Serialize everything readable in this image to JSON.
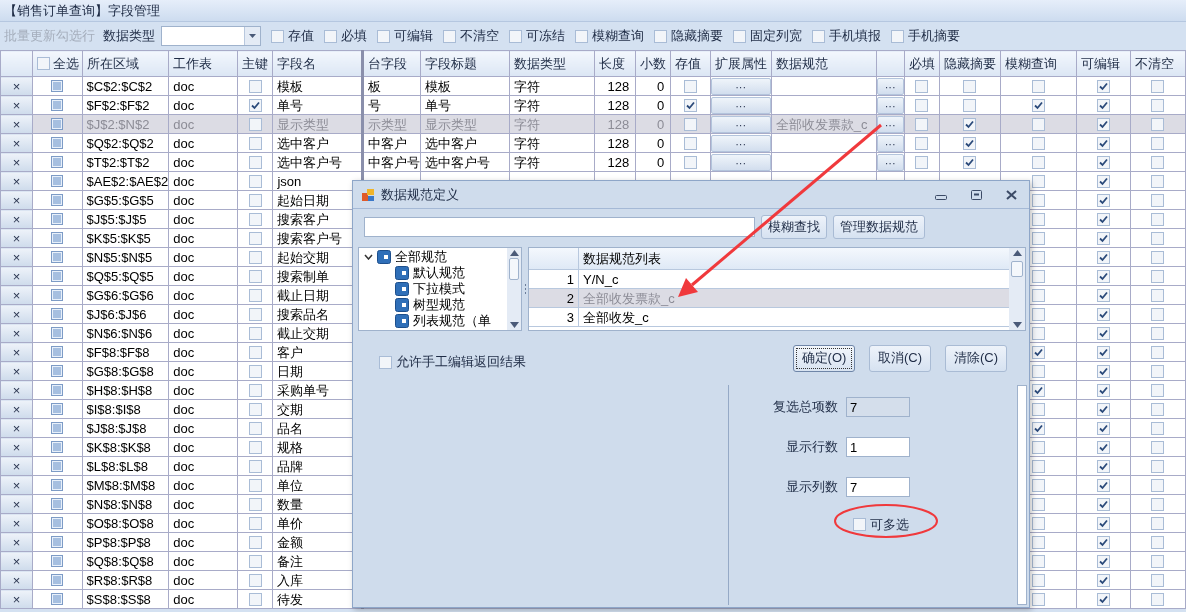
{
  "window": {
    "title": "【销售订单查询】字段管理"
  },
  "toolbar": {
    "batch_update": {
      "label": "批量更新勾选行",
      "disabled": true
    },
    "data_type_label": "数据类型",
    "options": [
      {
        "label": "存值",
        "checked": false
      },
      {
        "label": "必填",
        "checked": false
      },
      {
        "label": "可编辑",
        "checked": false
      },
      {
        "label": "不清空",
        "checked": false
      },
      {
        "label": "可冻结",
        "checked": false
      },
      {
        "label": "模糊查询",
        "checked": false
      },
      {
        "label": "隐藏摘要",
        "checked": false
      },
      {
        "label": "固定列宽",
        "checked": false
      },
      {
        "label": "手机填报",
        "checked": false
      },
      {
        "label": "手机摘要",
        "checked": false
      }
    ]
  },
  "table": {
    "columns": [
      {
        "kind": "delete"
      },
      {
        "kind": "select",
        "label": "全选",
        "checked": false
      },
      {
        "kind": "text",
        "label": "所在区域"
      },
      {
        "kind": "text",
        "label": "工作表"
      },
      {
        "kind": "check",
        "label": "主键"
      },
      {
        "kind": "text",
        "label": "字段名"
      },
      {
        "kind": "text",
        "label": "台字段"
      },
      {
        "kind": "text",
        "label": "字段标题"
      },
      {
        "kind": "text",
        "label": "数据类型"
      },
      {
        "kind": "num",
        "label": "长度"
      },
      {
        "kind": "num",
        "label": "小数"
      },
      {
        "kind": "check",
        "label": "存值"
      },
      {
        "kind": "button",
        "label": "扩展属性"
      },
      {
        "kind": "text",
        "label": "数据规范"
      },
      {
        "kind": "button"
      },
      {
        "kind": "check",
        "label": "必填"
      },
      {
        "kind": "check",
        "label": "隐藏摘要"
      },
      {
        "kind": "check",
        "label": "模糊查询"
      },
      {
        "kind": "check",
        "label": "可编辑"
      },
      {
        "kind": "check",
        "label": "不清空"
      }
    ],
    "rows": [
      {
        "selected": false,
        "cells": [
          "×",
          null,
          "$C$2:$C$2",
          "doc",
          false,
          "模板",
          "板",
          "模板",
          "字符",
          "128",
          "0",
          false,
          "···",
          null,
          "···",
          false,
          false,
          false,
          true,
          false
        ]
      },
      {
        "selected": false,
        "cells": [
          "×",
          null,
          "$F$2:$F$2",
          "doc",
          true,
          "单号",
          "号",
          "单号",
          "字符",
          "128",
          "0",
          true,
          "···",
          null,
          "···",
          false,
          false,
          true,
          true,
          false
        ]
      },
      {
        "selected": true,
        "cells": [
          "×",
          null,
          "$J$2:$N$2",
          "doc",
          false,
          "显示类型",
          "示类型",
          "显示类型",
          "字符",
          "128",
          "0",
          false,
          "···",
          "全部收发票款_c",
          "···",
          false,
          true,
          false,
          true,
          false
        ]
      },
      {
        "selected": false,
        "cells": [
          "×",
          null,
          "$Q$2:$Q$2",
          "doc",
          false,
          "选中客户",
          "中客户",
          "选中客户",
          "字符",
          "128",
          "0",
          false,
          "···",
          null,
          "···",
          false,
          true,
          false,
          true,
          false
        ]
      },
      {
        "selected": false,
        "cells": [
          "×",
          null,
          "$T$2:$T$2",
          "doc",
          false,
          "选中客户号",
          "中客户号",
          "选中客户号",
          "字符",
          "128",
          "0",
          false,
          "···",
          null,
          "···",
          false,
          true,
          false,
          true,
          false
        ]
      },
      {
        "selected": false,
        "cells": [
          "×",
          null,
          "$AE$2:$AE$2",
          "doc",
          false,
          "json",
          null,
          null,
          null,
          null,
          null,
          null,
          null,
          null,
          null,
          null,
          null,
          false,
          true,
          false
        ]
      },
      {
        "selected": false,
        "cells": [
          "×",
          null,
          "$G$5:$G$5",
          "doc",
          false,
          "起始日期",
          null,
          null,
          null,
          null,
          null,
          null,
          null,
          null,
          null,
          null,
          null,
          false,
          true,
          false
        ]
      },
      {
        "selected": false,
        "cells": [
          "×",
          null,
          "$J$5:$J$5",
          "doc",
          false,
          "搜索客户",
          null,
          null,
          null,
          null,
          null,
          null,
          null,
          null,
          null,
          null,
          null,
          false,
          true,
          false
        ]
      },
      {
        "selected": false,
        "cells": [
          "×",
          null,
          "$K$5:$K$5",
          "doc",
          false,
          "搜索客户号",
          null,
          null,
          null,
          null,
          null,
          null,
          null,
          null,
          null,
          null,
          null,
          false,
          true,
          false
        ]
      },
      {
        "selected": false,
        "cells": [
          "×",
          null,
          "$N$5:$N$5",
          "doc",
          false,
          "起始交期",
          null,
          null,
          null,
          null,
          null,
          null,
          null,
          null,
          null,
          null,
          null,
          false,
          true,
          false
        ]
      },
      {
        "selected": false,
        "cells": [
          "×",
          null,
          "$Q$5:$Q$5",
          "doc",
          false,
          "搜索制单",
          null,
          null,
          null,
          null,
          null,
          null,
          null,
          null,
          null,
          null,
          null,
          false,
          true,
          false
        ]
      },
      {
        "selected": false,
        "cells": [
          "×",
          null,
          "$G$6:$G$6",
          "doc",
          false,
          "截止日期",
          null,
          null,
          null,
          null,
          null,
          null,
          null,
          null,
          null,
          null,
          null,
          false,
          true,
          false
        ]
      },
      {
        "selected": false,
        "cells": [
          "×",
          null,
          "$J$6:$J$6",
          "doc",
          false,
          "搜索品名",
          null,
          null,
          null,
          null,
          null,
          null,
          null,
          null,
          null,
          null,
          null,
          false,
          true,
          false
        ]
      },
      {
        "selected": false,
        "cells": [
          "×",
          null,
          "$N$6:$N$6",
          "doc",
          false,
          "截止交期",
          null,
          null,
          null,
          null,
          null,
          null,
          null,
          null,
          null,
          null,
          null,
          false,
          true,
          false
        ]
      },
      {
        "selected": false,
        "cells": [
          "×",
          null,
          "$F$8:$F$8",
          "doc",
          false,
          "客户",
          null,
          null,
          null,
          null,
          null,
          null,
          null,
          null,
          null,
          null,
          null,
          true,
          true,
          false
        ]
      },
      {
        "selected": false,
        "cells": [
          "×",
          null,
          "$G$8:$G$8",
          "doc",
          false,
          "日期",
          null,
          null,
          null,
          null,
          null,
          null,
          null,
          null,
          null,
          null,
          null,
          false,
          true,
          false
        ]
      },
      {
        "selected": false,
        "cells": [
          "×",
          null,
          "$H$8:$H$8",
          "doc",
          false,
          "采购单号",
          null,
          null,
          null,
          null,
          null,
          null,
          null,
          null,
          null,
          null,
          null,
          true,
          true,
          false
        ]
      },
      {
        "selected": false,
        "cells": [
          "×",
          null,
          "$I$8:$I$8",
          "doc",
          false,
          "交期",
          null,
          null,
          null,
          null,
          null,
          null,
          null,
          null,
          null,
          null,
          null,
          false,
          true,
          false
        ]
      },
      {
        "selected": false,
        "cells": [
          "×",
          null,
          "$J$8:$J$8",
          "doc",
          false,
          "品名",
          null,
          null,
          null,
          null,
          null,
          null,
          null,
          null,
          null,
          null,
          null,
          true,
          true,
          false
        ]
      },
      {
        "selected": false,
        "cells": [
          "×",
          null,
          "$K$8:$K$8",
          "doc",
          false,
          "规格",
          null,
          null,
          null,
          null,
          null,
          null,
          null,
          null,
          null,
          null,
          null,
          false,
          true,
          false
        ]
      },
      {
        "selected": false,
        "cells": [
          "×",
          null,
          "$L$8:$L$8",
          "doc",
          false,
          "品牌",
          null,
          null,
          null,
          null,
          null,
          null,
          null,
          null,
          null,
          null,
          null,
          false,
          true,
          false
        ]
      },
      {
        "selected": false,
        "cells": [
          "×",
          null,
          "$M$8:$M$8",
          "doc",
          false,
          "单位",
          null,
          null,
          null,
          null,
          null,
          null,
          null,
          null,
          null,
          null,
          null,
          false,
          true,
          false
        ]
      },
      {
        "selected": false,
        "cells": [
          "×",
          null,
          "$N$8:$N$8",
          "doc",
          false,
          "数量",
          null,
          null,
          null,
          null,
          null,
          null,
          null,
          null,
          null,
          null,
          null,
          false,
          true,
          false
        ]
      },
      {
        "selected": false,
        "cells": [
          "×",
          null,
          "$O$8:$O$8",
          "doc",
          false,
          "单价",
          null,
          null,
          null,
          null,
          null,
          null,
          null,
          null,
          null,
          null,
          null,
          false,
          true,
          false
        ]
      },
      {
        "selected": false,
        "cells": [
          "×",
          null,
          "$P$8:$P$8",
          "doc",
          false,
          "金额",
          null,
          null,
          null,
          null,
          null,
          null,
          null,
          null,
          null,
          null,
          null,
          false,
          true,
          false
        ]
      },
      {
        "selected": false,
        "cells": [
          "×",
          null,
          "$Q$8:$Q$8",
          "doc",
          false,
          "备注",
          null,
          null,
          null,
          null,
          null,
          null,
          null,
          null,
          null,
          null,
          null,
          false,
          true,
          false
        ]
      },
      {
        "selected": false,
        "cells": [
          "×",
          null,
          "$R$8:$R$8",
          "doc",
          false,
          "入库",
          null,
          null,
          null,
          null,
          null,
          null,
          null,
          null,
          null,
          null,
          null,
          false,
          true,
          false
        ]
      },
      {
        "selected": false,
        "cells": [
          "×",
          null,
          "$S$8:$S$8",
          "doc",
          false,
          "待发",
          null,
          null,
          null,
          null,
          null,
          null,
          null,
          null,
          null,
          null,
          null,
          false,
          true,
          false
        ]
      }
    ]
  },
  "dialog": {
    "title": "数据规范定义",
    "search_buttons": [
      "模糊查找",
      "管理数据规范"
    ],
    "tree": {
      "label": "全部规范",
      "expanded": true,
      "children": [
        {
          "label": "默认规范"
        },
        {
          "label": "下拉模式"
        },
        {
          "label": "树型规范"
        },
        {
          "label": "列表规范（单"
        }
      ]
    },
    "list": {
      "header": "数据规范列表",
      "rows": [
        {
          "index": "1",
          "label": "Y/N_c",
          "selected": false
        },
        {
          "index": "2",
          "label": "全部收发票款_c",
          "selected": true
        },
        {
          "index": "3",
          "label": "全部收发_c",
          "selected": false
        }
      ]
    },
    "allow_manual_edit": {
      "label": "允许手工编辑返回结果",
      "checked": false
    },
    "buttons": [
      {
        "label": "确定(O)",
        "focused": true
      },
      {
        "label": "取消(C)",
        "focused": false
      },
      {
        "label": "清除(C)",
        "focused": false
      }
    ],
    "fields": [
      {
        "label": "复选总项数",
        "value": "7",
        "disabled": true
      },
      {
        "label": "显示行数",
        "value": "1",
        "disabled": false
      },
      {
        "label": "显示列数",
        "value": "7",
        "disabled": false
      }
    ],
    "multi_select": {
      "label": "可多选",
      "checked": false
    }
  }
}
